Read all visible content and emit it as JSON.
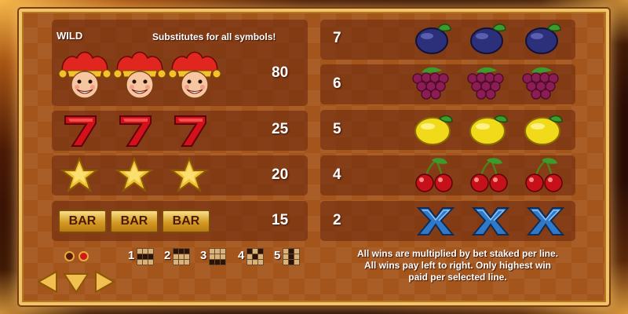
{
  "paytable": {
    "wild": {
      "label": "WILD",
      "description": "Substitutes for all symbols!",
      "payout": "80",
      "symbol": "jester-wild"
    },
    "left_rows": [
      {
        "symbol": "red-seven",
        "payout": "25"
      },
      {
        "symbol": "gold-star",
        "payout": "20"
      },
      {
        "symbol": "bar",
        "symbol_text": "BAR",
        "payout": "15"
      }
    ],
    "right_rows": [
      {
        "symbol": "plum",
        "payout": "7"
      },
      {
        "symbol": "grapes",
        "payout": "6"
      },
      {
        "symbol": "lemon",
        "payout": "5"
      },
      {
        "symbol": "cherries",
        "payout": "4"
      },
      {
        "symbol": "blue-x",
        "payout": "2"
      }
    ]
  },
  "paylines": {
    "labels": [
      "1",
      "2",
      "3",
      "4",
      "5"
    ]
  },
  "notes": {
    "line1": "All wins are multiplied by bet staked per line.",
    "line2": "All wins pay left to right. Only highest win",
    "line3": "paid per selected line."
  },
  "pagination": {
    "pages": 2,
    "current": 2
  },
  "navigation": {
    "icons": [
      "arrow-left-icon",
      "arrow-down-icon",
      "arrow-right-icon"
    ]
  },
  "colors": {
    "frame_gold": "#f1c46b",
    "panel_brown": "#702c0e",
    "background": "#a4551c"
  }
}
